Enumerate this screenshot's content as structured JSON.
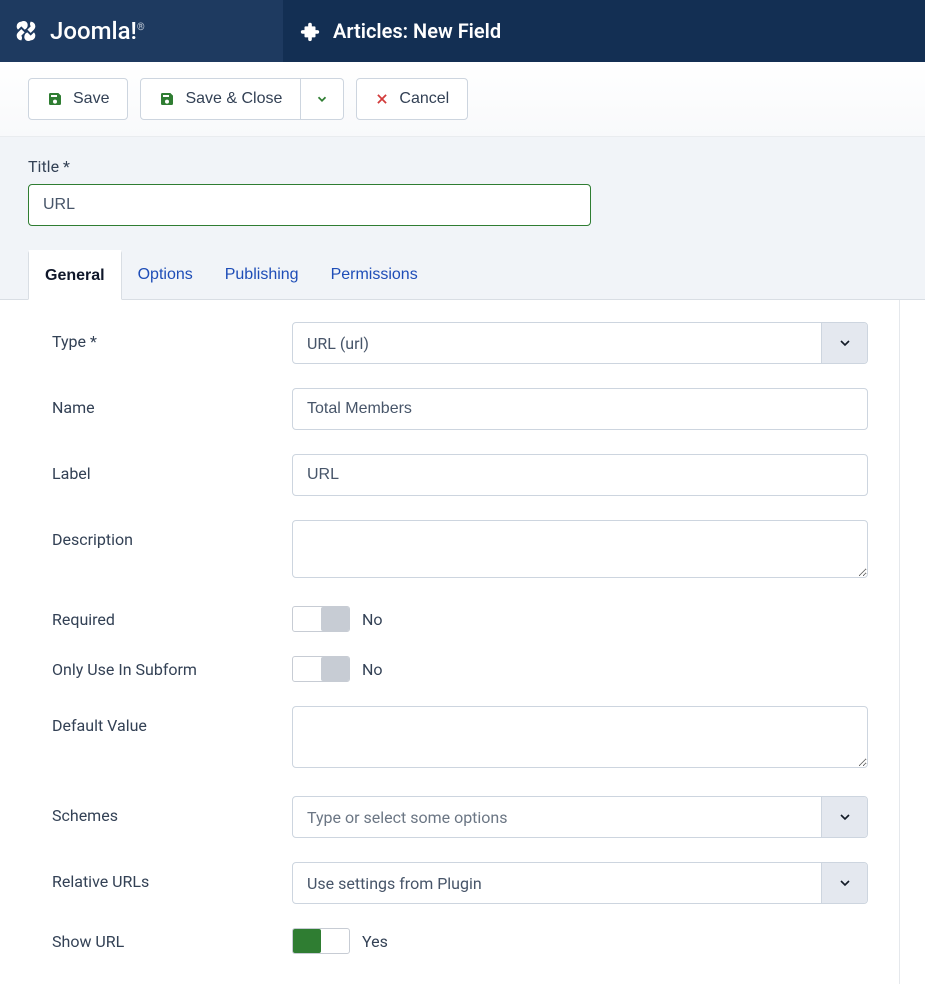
{
  "brand": "Joomla!",
  "page_header": "Articles: New Field",
  "toolbar": {
    "save": "Save",
    "save_close": "Save & Close",
    "cancel": "Cancel"
  },
  "title": {
    "label": "Title *",
    "value": "URL"
  },
  "tabs": {
    "general": "General",
    "options": "Options",
    "publishing": "Publishing",
    "permissions": "Permissions"
  },
  "form": {
    "type": {
      "label": "Type *",
      "value": "URL (url)"
    },
    "name": {
      "label": "Name",
      "value": "Total Members"
    },
    "label_field": {
      "label": "Label",
      "value": "URL"
    },
    "description": {
      "label": "Description",
      "value": ""
    },
    "required": {
      "label": "Required",
      "state_text": "No"
    },
    "subform": {
      "label": "Only Use In Subform",
      "state_text": "No"
    },
    "default_value": {
      "label": "Default Value",
      "value": ""
    },
    "schemes": {
      "label": "Schemes",
      "placeholder": "Type or select some options"
    },
    "relative_urls": {
      "label": "Relative URLs",
      "value": "Use settings from Plugin"
    },
    "show_url": {
      "label": "Show URL",
      "state_text": "Yes"
    }
  }
}
